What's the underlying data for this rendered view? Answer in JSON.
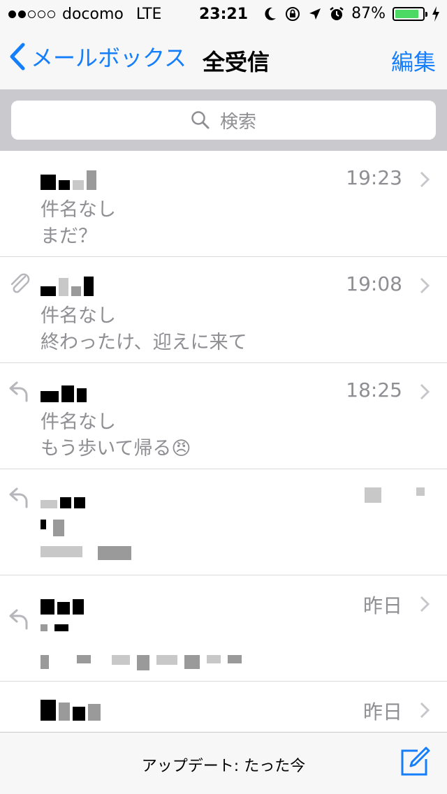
{
  "statusbar": {
    "carrier": "docomo",
    "network": "LTE",
    "time": "23:21",
    "battery": "87%",
    "battery_level": 0.87
  },
  "nav": {
    "back_label": "メールボックス",
    "title": "全受信",
    "edit_label": "編集"
  },
  "search": {
    "placeholder": "検索"
  },
  "mails": [
    {
      "time": "19:23",
      "subject": "件名なし",
      "preview": "まだ？",
      "icon": "none"
    },
    {
      "time": "19:08",
      "subject": "件名なし",
      "preview": "終わったけ、迎えに来て",
      "icon": "paperclip-icon"
    },
    {
      "time": "18:25",
      "subject": "件名なし",
      "preview": "もう歩いて帰る",
      "emoji": "😠",
      "icon": "reply-icon"
    },
    {
      "time": "",
      "subject": "",
      "preview": "",
      "icon": "reply-icon"
    },
    {
      "time": "昨日",
      "subject": "",
      "preview": "",
      "icon": "reply-icon"
    },
    {
      "time": "昨日",
      "subject": "",
      "preview": "",
      "icon": "none"
    }
  ],
  "toolbar": {
    "update_text": "アップデート: たった今"
  },
  "colors": {
    "accent": "#157efb",
    "secondary_text": "#8e8e93",
    "battery_fill": "#4cd964"
  }
}
